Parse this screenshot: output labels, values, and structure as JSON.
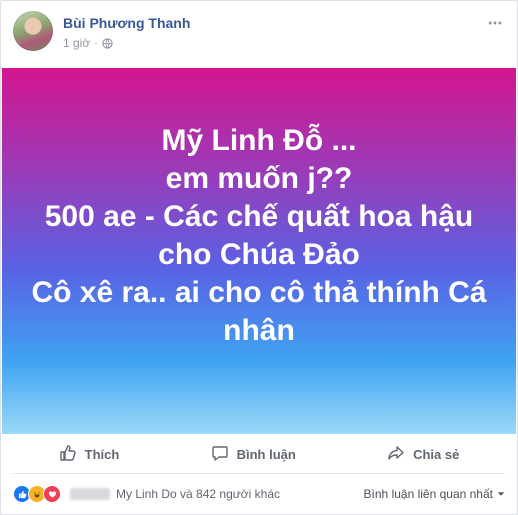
{
  "post": {
    "author": "Bùi Phương Thanh",
    "time": "1 giờ",
    "privacy_icon": "globe-icon",
    "more_icon": "more-options-icon",
    "banner": {
      "lines": [
        "Mỹ Linh Đỗ ...",
        "em muốn j??",
        "500 ae - Các chế quất hoa hậu",
        "cho Chúa Đảo",
        "Cô xê ra.. ai cho cô thả thính Cá",
        "nhân"
      ],
      "gradient_colors": [
        "#d3158f",
        "#9b3bb8",
        "#5962e4",
        "#3fa3f2",
        "#9ad9f8"
      ]
    }
  },
  "actions": {
    "like": "Thích",
    "comment": "Bình luận",
    "share": "Chia sẻ"
  },
  "reactions": {
    "types": [
      "like",
      "haha",
      "love"
    ],
    "summary": "My Linh Do và 842 người khác",
    "sort_label": "Bình luận liên quan nhất"
  },
  "colors": {
    "link": "#385898",
    "muted": "#90949c",
    "action_text": "#616770"
  }
}
